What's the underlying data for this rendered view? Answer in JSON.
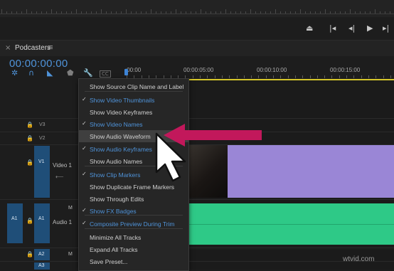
{
  "panel": {
    "close": "×",
    "title": "Podcasters",
    "menu": "≡"
  },
  "timecode": "00:00:00:00",
  "ruler_times": [
    ":00:00",
    "00:00:05:00",
    "00:00:10:00",
    "00:00:15:00"
  ],
  "transport_icons": [
    "lift-icon",
    "mark-in-icon",
    "step-back-icon",
    "play-icon",
    "step-forward-icon",
    "mark-out-icon"
  ],
  "tools": [
    "snap-icon",
    "linked-selection-icon",
    "add-marker-icon",
    "marker-icon",
    "wrench-icon",
    "captions-icon"
  ],
  "tracks": {
    "v3": "V3",
    "v2": "V2",
    "v1": "V1",
    "v1_name": "Video 1",
    "a1_source": "A1",
    "a1": "A1",
    "a1_mute": "M",
    "a1_name": "Audio 1",
    "a2": "A2",
    "a2_mute": "M",
    "a3": "A3"
  },
  "menu_items": [
    {
      "label": "Show Source Clip Name and Label",
      "checked": false
    },
    {
      "label": "Show Video Thumbnails",
      "checked": true
    },
    {
      "label": "Show Video Keyframes",
      "checked": false
    },
    {
      "label": "Show Video Names",
      "checked": true
    },
    {
      "label": "Show Audio Waveform",
      "checked": false,
      "highlighted": true
    },
    {
      "label": "Show Audio Keyframes",
      "checked": true
    },
    {
      "label": "Show Audio Names",
      "checked": false
    },
    {
      "label": "Show Clip Markers",
      "checked": true
    },
    {
      "label": "Show Duplicate Frame Markers",
      "checked": false
    },
    {
      "label": "Show Through Edits",
      "checked": false
    },
    {
      "label": "Show FX Badges",
      "checked": true
    },
    {
      "label": "Composite Preview During Trim",
      "checked": true
    },
    {
      "label": "Minimize All Tracks",
      "checked": false
    },
    {
      "label": "Expand All Tracks",
      "checked": false
    },
    {
      "label": "Save Preset...",
      "checked": false
    }
  ],
  "check_glyph": "✓",
  "colors": {
    "accent_blue": "#4f93d9",
    "video_clip": "#9a86d6",
    "audio_clip": "#2ec987",
    "annotation_arrow": "#c2185b",
    "work_area_bar": "#d6c72a"
  },
  "watermark": "wtvid.com"
}
